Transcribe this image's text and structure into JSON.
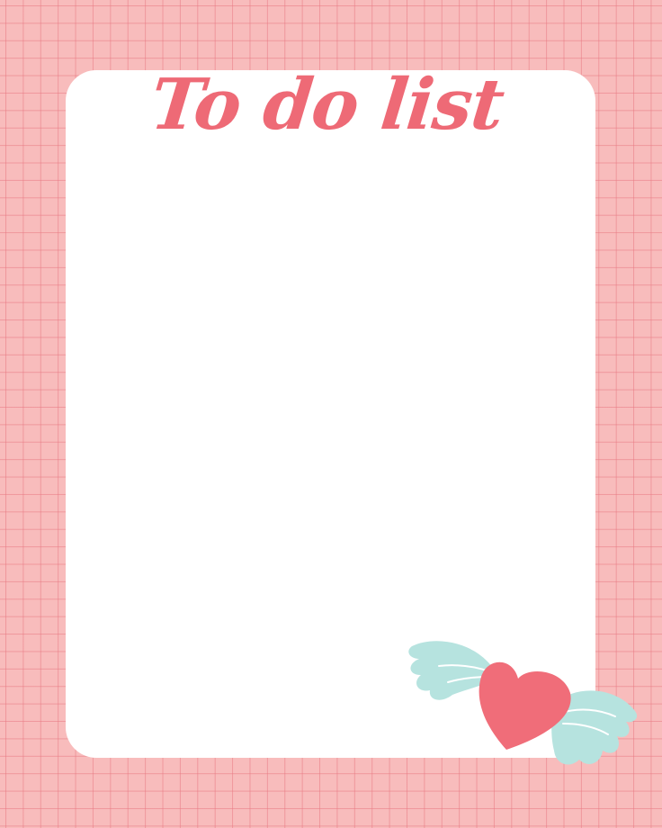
{
  "title": "To do list",
  "colors": {
    "grid_background": "#f8bcbc",
    "grid_lines": "#e87882",
    "card": "#ffffff",
    "title": "#ee6a76",
    "heart": "#f06d79",
    "wings": "#b6e3df",
    "wing_feather_lines": "#ffffff"
  },
  "decoration": {
    "icon": "winged-heart-icon"
  }
}
